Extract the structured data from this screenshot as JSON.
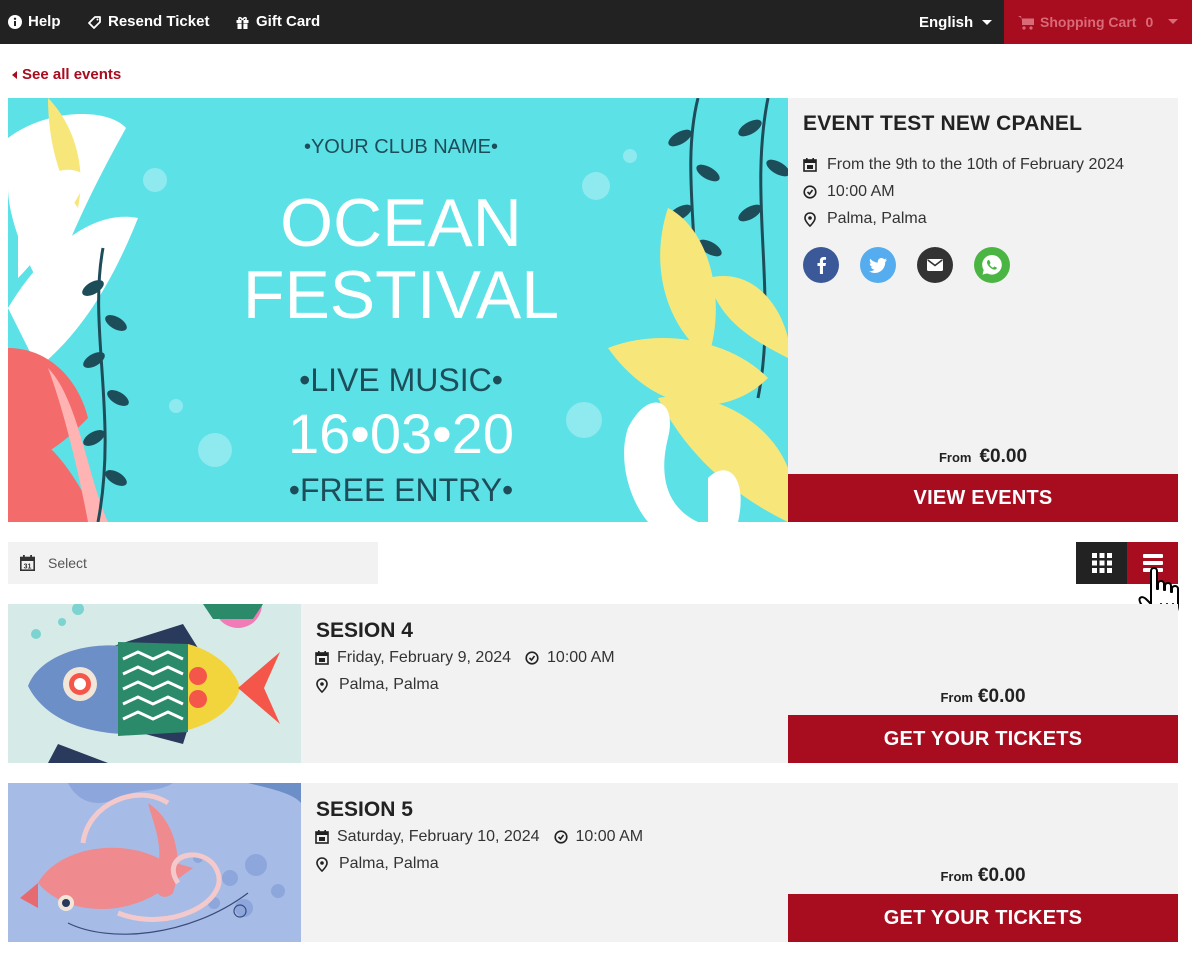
{
  "topbar": {
    "help": "Help",
    "resend": "Resend Ticket",
    "gift": "Gift Card",
    "language": "English",
    "cart_label": "Shopping Cart",
    "cart_count": "0"
  },
  "back_link": "See all events",
  "hero": {
    "poster": {
      "club": "•YOUR CLUB NAME•",
      "line1": "OCEAN",
      "line2": "FESTIVAL",
      "music": "•LIVE MUSIC•",
      "date": "16•03•20",
      "entry": "•FREE ENTRY•"
    },
    "title": "EVENT TEST NEW CPANEL",
    "dates": "From the 9th to the 10th of February 2024",
    "time": "10:00 AM",
    "location": "Palma, Palma",
    "from_label": "From",
    "price": "€0.00",
    "button": "VIEW EVENTS"
  },
  "filter": {
    "date_placeholder": "Select"
  },
  "sessions": [
    {
      "name": "SESION 4",
      "date": "Friday, February 9, 2024",
      "time": "10:00 AM",
      "location": "Palma, Palma",
      "from_label": "From",
      "price": "€0.00",
      "button": "GET YOUR TICKETS"
    },
    {
      "name": "SESION 5",
      "date": "Saturday, February 10, 2024",
      "time": "10:00 AM",
      "location": "Palma, Palma",
      "from_label": "From",
      "price": "€0.00",
      "button": "GET YOUR TICKETS"
    }
  ],
  "colors": {
    "brand_red": "#a80c1f",
    "topbar": "#222222",
    "panel": "#f2f2f2",
    "poster_bg": "#5ce1e6"
  }
}
